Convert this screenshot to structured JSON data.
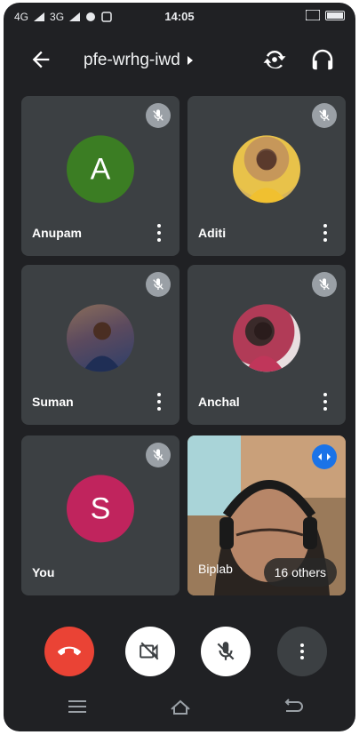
{
  "statusbar": {
    "network1": "4G",
    "network2": "3G",
    "time": "14:05"
  },
  "header": {
    "meeting_code": "pfe-wrhg-iwd"
  },
  "participants": [
    {
      "name": "Anupam",
      "initial": "A",
      "avatar_color": "#3b7d23",
      "muted": true
    },
    {
      "name": "Aditi",
      "initial": "",
      "avatar_color": "#c69a54",
      "muted": true
    },
    {
      "name": "Suman",
      "initial": "",
      "avatar_color": "#6b4b3c",
      "muted": true
    },
    {
      "name": "Anchal",
      "initial": "",
      "avatar_color": "#a53a52",
      "muted": true
    },
    {
      "name": "You",
      "initial": "S",
      "avatar_color": "#c0245d",
      "muted": true
    },
    {
      "name": "Biplab",
      "video": true
    }
  ],
  "others_label": "16 others",
  "colors": {
    "background": "#202124",
    "tile": "#3c4043",
    "end_call": "#ea4335",
    "accent": "#1a73e8"
  },
  "controls": [
    "end-call",
    "camera-off",
    "mic-off",
    "more-options"
  ]
}
